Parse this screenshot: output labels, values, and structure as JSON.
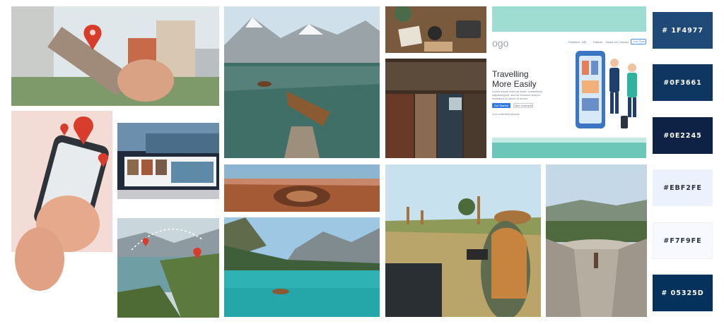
{
  "mockup": {
    "logo": "ogo",
    "nav": [
      "Solutions",
      "API",
      "Partner",
      "About Us",
      "Contact"
    ],
    "nav_button": "Get Start",
    "headline_line1": "Travelling",
    "headline_line2": "More Easily",
    "paragraph": "Lorem ipsum dolor sit amet, consectetur adipiscing elit, sed do eiusmod tempor incididunt ut labore et dolore.",
    "primary_button": "Get Started",
    "secondary_button": "Take a sample",
    "note": "3 for unlimited access"
  },
  "palette": [
    {
      "label": "# 1F4977",
      "hex": "#1F4977",
      "text": "#ffffff"
    },
    {
      "label": "#0F3661",
      "hex": "#0F3661",
      "text": "#ffffff"
    },
    {
      "label": "#0E2245",
      "hex": "#0E2245",
      "text": "#ffffff"
    },
    {
      "label": "#EBF2FE",
      "hex": "#EBF2FE",
      "text": "#2a3344"
    },
    {
      "label": "#F7F9FE",
      "hex": "#F7F9FE",
      "text": "#2a3344"
    },
    {
      "label": "# 05325D",
      "hex": "#05325D",
      "text": "#ffffff"
    }
  ]
}
